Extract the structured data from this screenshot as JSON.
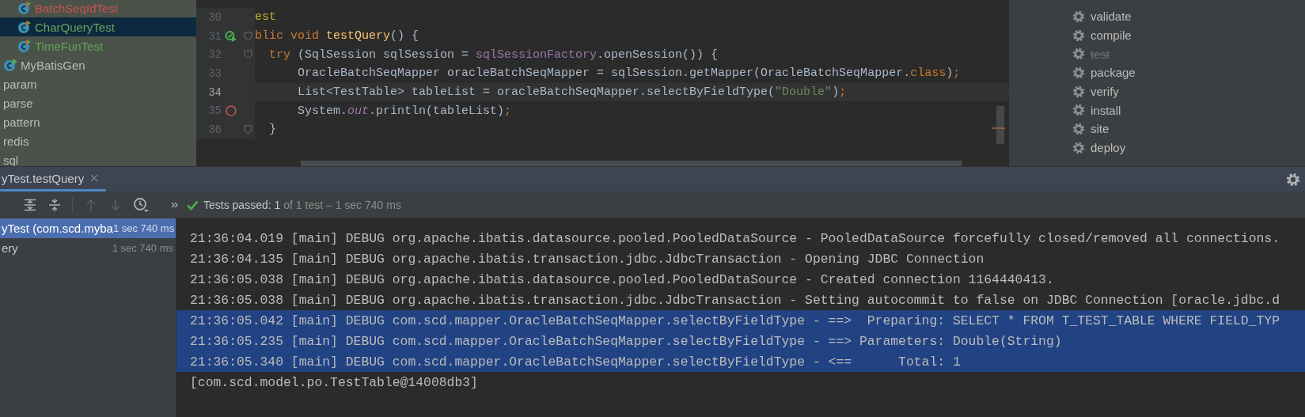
{
  "project_tree": [
    {
      "label": "BatchSeqIdTest",
      "kind": "test-class",
      "color": "#c75450",
      "selected": false
    },
    {
      "label": "CharQueryTest",
      "kind": "test-class",
      "color": "#62a35a",
      "selected": true
    },
    {
      "label": "TimeFunTest",
      "kind": "test-class",
      "color": "#62a35a",
      "selected": false
    },
    {
      "label": "MyBatisGen",
      "kind": "runnable-class",
      "color": "#bbbbbb",
      "selected": false
    },
    {
      "label": "param",
      "kind": "package",
      "color": "#bbbbbb",
      "selected": false
    },
    {
      "label": "parse",
      "kind": "package",
      "color": "#bbbbbb",
      "selected": false
    },
    {
      "label": "pattern",
      "kind": "package",
      "color": "#bbbbbb",
      "selected": false
    },
    {
      "label": "redis",
      "kind": "package",
      "color": "#bbbbbb",
      "selected": false
    },
    {
      "label": "sql",
      "kind": "package",
      "color": "#bbbbbb",
      "selected": false
    }
  ],
  "editor": {
    "lines": [
      {
        "number": "30",
        "current": false,
        "fold": false,
        "run_marker": false,
        "breakpoint": false,
        "tokens": [
          {
            "text": "est",
            "kind": "annotation"
          }
        ]
      },
      {
        "number": "31",
        "current": false,
        "fold": true,
        "run_marker": true,
        "breakpoint": false,
        "tokens": [
          {
            "text": "blic void ",
            "kind": "keyword"
          },
          {
            "text": "testQuery",
            "kind": "method"
          },
          {
            "text": "() {",
            "kind": "plain"
          }
        ]
      },
      {
        "number": "32",
        "current": false,
        "fold": true,
        "run_marker": false,
        "breakpoint": false,
        "tokens": [
          {
            "text": "  try ",
            "kind": "keyword"
          },
          {
            "text": "(SqlSession sqlSession = ",
            "kind": "plain"
          },
          {
            "text": "sqlSessionFactory",
            "kind": "field"
          },
          {
            "text": ".openSession()) {",
            "kind": "plain"
          }
        ]
      },
      {
        "number": "33",
        "current": false,
        "fold": false,
        "run_marker": false,
        "breakpoint": false,
        "tokens": [
          {
            "text": "      OracleBatchSeqMapper oracleBatchSeqMapper = sqlSession.getMapper(OracleBatchSeqMapper.",
            "kind": "plain"
          },
          {
            "text": "class",
            "kind": "keyword"
          },
          {
            "text": ")",
            "kind": "plain"
          },
          {
            "text": ";",
            "kind": "keyword"
          }
        ]
      },
      {
        "number": "34",
        "current": true,
        "fold": false,
        "run_marker": false,
        "breakpoint": false,
        "tokens": [
          {
            "text": "      List<TestTable> tableList = oracleBatchSeqMapper.selectByFieldType(",
            "kind": "plain"
          },
          {
            "text": "\"Double\"",
            "kind": "string"
          },
          {
            "text": ")",
            "kind": "plain"
          },
          {
            "text": ";",
            "kind": "keyword"
          }
        ]
      },
      {
        "number": "35",
        "current": false,
        "fold": false,
        "run_marker": false,
        "breakpoint": true,
        "tokens": [
          {
            "text": "      System.",
            "kind": "plain"
          },
          {
            "text": "out",
            "kind": "static-field"
          },
          {
            "text": ".println(tableList)",
            "kind": "plain"
          },
          {
            "text": ";",
            "kind": "keyword"
          }
        ]
      },
      {
        "number": "36",
        "current": false,
        "fold": true,
        "run_marker": false,
        "breakpoint": false,
        "tokens": [
          {
            "text": "  }",
            "kind": "plain"
          }
        ]
      }
    ]
  },
  "maven_lifecycle": [
    {
      "label": "validate",
      "disabled": false
    },
    {
      "label": "compile",
      "disabled": false
    },
    {
      "label": "test",
      "disabled": true
    },
    {
      "label": "package",
      "disabled": false
    },
    {
      "label": "verify",
      "disabled": false
    },
    {
      "label": "install",
      "disabled": false
    },
    {
      "label": "site",
      "disabled": false
    },
    {
      "label": "deploy",
      "disabled": false
    }
  ],
  "run_panel": {
    "tabs": [
      {
        "label": "yTest.testQuery",
        "selected": true
      }
    ],
    "status": {
      "summary": "Tests passed: 1",
      "detail": "of 1 test – 1 sec 740 ms"
    },
    "test_tree": [
      {
        "label": "yTest (com.scd.myba",
        "duration": "1 sec 740 ms",
        "selected": true
      },
      {
        "label": "ery",
        "duration": "1 sec 740 ms",
        "selected": false
      }
    ],
    "console": [
      {
        "text": "21:36:04.019 [main] DEBUG org.apache.ibatis.datasource.pooled.PooledDataSource - PooledDataSource forcefully closed/removed all connections.",
        "selected": false
      },
      {
        "text": "21:36:04.135 [main] DEBUG org.apache.ibatis.transaction.jdbc.JdbcTransaction - Opening JDBC Connection",
        "selected": false
      },
      {
        "text": "21:36:05.038 [main] DEBUG org.apache.ibatis.datasource.pooled.PooledDataSource - Created connection 1164440413.",
        "selected": false
      },
      {
        "text": "21:36:05.038 [main] DEBUG org.apache.ibatis.transaction.jdbc.JdbcTransaction - Setting autocommit to false on JDBC Connection [oracle.jdbc.d",
        "selected": false
      },
      {
        "text": "21:36:05.042 [main] DEBUG com.scd.mapper.OracleBatchSeqMapper.selectByFieldType - ==>  Preparing: SELECT * FROM T_TEST_TABLE WHERE FIELD_TYP",
        "selected": true
      },
      {
        "text": "21:36:05.235 [main] DEBUG com.scd.mapper.OracleBatchSeqMapper.selectByFieldType - ==> Parameters: Double(String)",
        "selected": true
      },
      {
        "text": "21:36:05.340 [main] DEBUG com.scd.mapper.OracleBatchSeqMapper.selectByFieldType - <==      Total: 1",
        "selected": true
      },
      {
        "text": "[com.scd.model.po.TestTable@14008db3]",
        "selected": false
      }
    ]
  }
}
